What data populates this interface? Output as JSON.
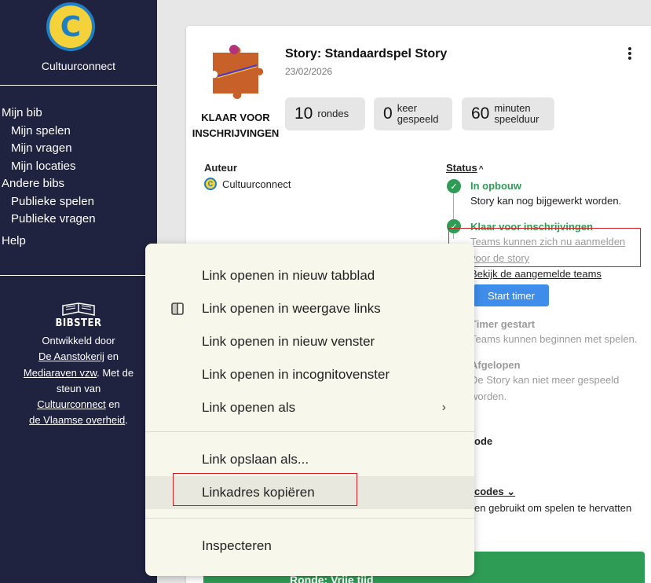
{
  "sidebar": {
    "logo_letter": "C",
    "org_name": "Cultuurconnect",
    "nav": [
      {
        "label": "Mijn bib",
        "sub": false
      },
      {
        "label": "Mijn spelen",
        "sub": true
      },
      {
        "label": "Mijn vragen",
        "sub": true
      },
      {
        "label": "Mijn locaties",
        "sub": true
      },
      {
        "label": "Andere bibs",
        "sub": false
      },
      {
        "label": "Publieke spelen",
        "sub": true
      },
      {
        "label": "Publieke vragen",
        "sub": true
      },
      {
        "label": "Help",
        "sub": false
      }
    ],
    "bibster_name": "BIBSTER",
    "credits": {
      "line1": "Ontwikkeld door",
      "link1": "De Aanstokerij",
      "t1": " en",
      "link2": "Mediaraven vzw",
      "t2": ". Met de",
      "t3": "steun van",
      "link3": "Cultuurconnect",
      "t4": " en",
      "link4": "de Vlaamse overheid",
      "t5": "."
    }
  },
  "story": {
    "title": "Story: Standaardspel Story",
    "date": "23/02/2026",
    "status_big_line1": "KLAAR VOOR",
    "status_big_line2": "INSCHRIJVINGEN",
    "stats": [
      {
        "value": "10",
        "label1": "rondes",
        "label2": ""
      },
      {
        "value": "0",
        "label1": "keer",
        "label2": "gespeeld"
      },
      {
        "value": "60",
        "label1": "minuten",
        "label2": "speelduur"
      }
    ],
    "auteur_label": "Auteur",
    "auteur_value": "Cultuurconnect",
    "status_label": "Status",
    "steps": {
      "s1_title": "In opbouw",
      "s1_text": "Story kan nog bijgewerkt worden.",
      "s2_title": "Klaar voor inschrijvingen",
      "s2_link_line1": "Teams kunnen zich nu aanmelden",
      "s2_link_line2": "voor de story",
      "s2_teams_link": "Bekijk de aangemelde teams",
      "start_timer": "Start timer",
      "s3_title": "Timer gestart",
      "s3_text": "Teams kunnen beginnen met spelen.",
      "s4_title": "Afgelopen",
      "s4_text_line1": "De Story kan niet meer gespeeld",
      "s4_text_line2": "worden."
    },
    "code_label_partial": "ode",
    "codes_label_partial": "codes",
    "codes_text_partial": "en gebruikt om spelen te hervatten",
    "bottom_bar_partial": "Ronde: Vrije tijd"
  },
  "context_menu": {
    "items": [
      "Link openen in nieuw tabblad",
      "Link openen in weergave links",
      "Link openen in nieuw venster",
      "Link openen in incognitovenster",
      "Link openen als",
      "Link opslaan als...",
      "Linkadres kopiëren",
      "Inspecteren"
    ],
    "highlighted_index": 6
  },
  "colors": {
    "sidebar_bg": "#1f2340",
    "accent_green": "#2e9c55",
    "button_blue": "#3f8dea",
    "annotation_red": "#d11d24",
    "menu_bg": "#f7f7ec"
  }
}
